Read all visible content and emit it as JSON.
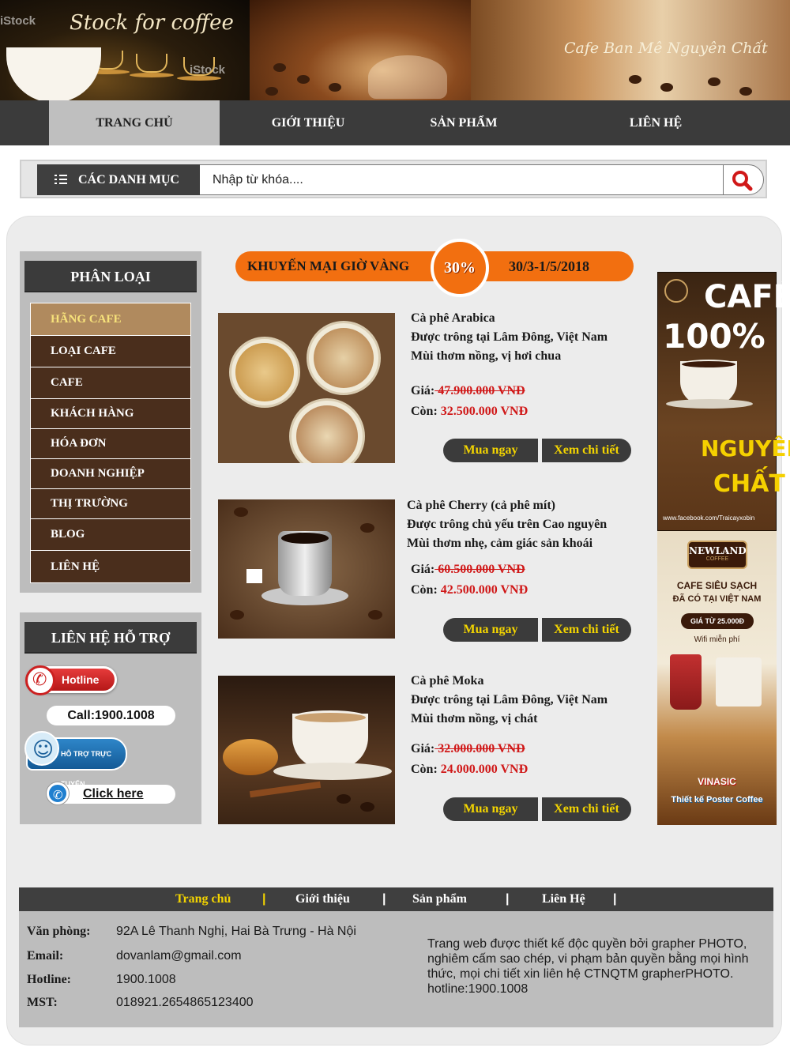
{
  "banner": {
    "left_script": "Stock for coffee",
    "stock_watermark": "iStock",
    "right_script": "Cafe Ban Mê Nguyên Chất"
  },
  "nav": {
    "items": [
      {
        "label": "TRANG CHỦ",
        "active": true
      },
      {
        "label": "GIỚI THIỆU"
      },
      {
        "label": "SẢN PHẨM"
      },
      {
        "label": "LIÊN HỆ"
      }
    ]
  },
  "search": {
    "category_label": "CÁC DANH MỤC",
    "placeholder": "Nhập từ khóa....",
    "category_icon": "list-icon",
    "button_icon": "search-icon"
  },
  "sidebar": {
    "title": "PHÂN LOẠI",
    "items": [
      {
        "label": "HÃNG CAFE",
        "active": true
      },
      {
        "label": "LOẠI CAFE"
      },
      {
        "label": "CAFE"
      },
      {
        "label": "KHÁCH HÀNG"
      },
      {
        "label": "HÓA ĐƠN"
      },
      {
        "label": "DOANH NGHIỆP"
      },
      {
        "label": "THỊ TRƯỜNG"
      },
      {
        "label": "BLOG"
      },
      {
        "label": "LIÊN HỆ"
      }
    ]
  },
  "support": {
    "title": "LIÊN HỆ HỖ TRỢ",
    "hotline_label": "Hotline",
    "call_text": "Call:1900.1008",
    "online_label": "HỖ TRỢ TRỰC TUYẾN",
    "click_text": "Click here"
  },
  "promo": {
    "left_text": "KHUYẾN MẠI GIỜ VÀNG",
    "badge": "30%",
    "date_range": "30/3-1/5/2018"
  },
  "products": [
    {
      "name": "Cà phê Arabica",
      "origin": "Được trông tại Lâm Đông, Việt Nam",
      "taste": "Mùi thơm nồng, vị hơi chua",
      "price_label": "Giá:",
      "old_price": " 47.900.000 VNĐ ",
      "remain_label": "Còn:",
      "new_price": "32.500.000 VNĐ",
      "buy_label": "Mua ngay",
      "detail_label": "Xem chi tiết"
    },
    {
      "name": "Cà phê Cherry (cả phê mít)",
      "origin": "Được trông chủ yếu trên Cao nguyên",
      "taste": "Mùi thơm nhẹ, cảm giác sản khoái",
      "price_label": "Giá:",
      "old_price": " 60.500.000 VNĐ ",
      "remain_label": "Còn:",
      "new_price": "42.500.000 VNĐ",
      "buy_label": "Mua ngay",
      "detail_label": "Xem chi tiết"
    },
    {
      "name": "Cà phê Moka",
      "origin": "Được trông tại Lâm Đông, Việt Nam",
      "taste": "Mùi thơm nồng, vị chát",
      "price_label": "Giá:",
      "old_price": " 32.000.000 VNĐ ",
      "remain_label": "Còn:",
      "new_price": "24.000.000 VNĐ",
      "buy_label": "Mua ngay",
      "detail_label": "Xem chi tiết"
    }
  ],
  "ads": {
    "ad1_line1": "CAFÉ",
    "ad1_line2": "100%",
    "ad1_line3": "NGUYÊN",
    "ad1_line4": "CHẤT",
    "ad1_small": "www.facebook.com/Traicayxobin",
    "ad2_brand": "NEWLAND",
    "ad2_brand_sub": "COFFEE",
    "ad2_line1": "CAFE SIÊU SẠCH",
    "ad2_line2": "ĐÃ CÓ TẠI VIỆT NAM",
    "ad2_price": "GIÁ TỪ 25.000Đ",
    "ad2_wifi": "Wifi miễn phí",
    "ad2_vinasic": "VINASIC",
    "ad2_footer": "Thiết kế Poster Coffee"
  },
  "footer": {
    "links": [
      {
        "label": "Trang chủ",
        "active": true
      },
      {
        "label": "Giới thiệu"
      },
      {
        "label": "Sản phẩm"
      },
      {
        "label": "Liên Hệ"
      }
    ],
    "separator": "|",
    "office_label": "Văn phòng:",
    "office_value": "92A Lê Thanh Nghị, Hai Bà Trưng - Hà Nội",
    "email_label": "Email:",
    "email_value": "dovanlam@gmail.com",
    "hotline_label": "Hotline:",
    "hotline_value": "1900.1008",
    "tax_label": "MST:",
    "tax_value": "018921.2654865123400",
    "note": "Trang web được thiết kế độc quyền bởi grapher PHOTO, nghiêm cấm sao chép, vi phạm bản quyền bằng mọi hình thức, mọi chi tiết xin liên hệ CTNQTM grapherPHOTO. hotline:1900.1008"
  },
  "colors": {
    "nav_bg": "#3b3b3b",
    "promo_orange": "#f26f10",
    "price_red": "#d01818",
    "button_text": "#f3d400",
    "menu_brown": "#4a2e1c"
  }
}
